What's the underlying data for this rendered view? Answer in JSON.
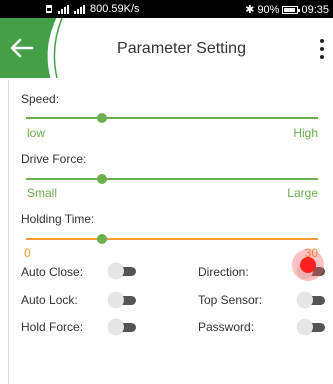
{
  "status_bar": {
    "net_speed": "800.59K/s",
    "bluetooth_symbol": "✱",
    "battery_percent": "90%",
    "battery_level": 0.9,
    "time": "09:35"
  },
  "header": {
    "title": "Parameter Setting",
    "back_icon": "arrow-left-icon",
    "menu_icon": "more-vert-icon"
  },
  "colors": {
    "accent_green": "#6ab04c",
    "header_green": "#44a047",
    "orange": "#f29b38",
    "touch_red": "#ff2020"
  },
  "sliders": [
    {
      "label": "Speed:",
      "min_label": "low",
      "max_label": "High",
      "value_fraction": 0.26,
      "color": "#6ab04c"
    },
    {
      "label": "Drive Force:",
      "min_label": "Small",
      "max_label": "Large",
      "value_fraction": 0.26,
      "color": "#6ab04c"
    },
    {
      "label": "Holding Time:",
      "min_label": "0",
      "max_label": "30",
      "value_fraction": 0.26,
      "color": "#f29b38"
    }
  ],
  "toggles": {
    "auto_close": {
      "label": "Auto Close:",
      "on": false
    },
    "direction": {
      "label": "Direction:",
      "on": false
    },
    "auto_lock": {
      "label": "Auto Lock:",
      "on": false
    },
    "top_sensor": {
      "label": "Top Sensor:",
      "on": false
    },
    "hold_force": {
      "label": "Hold Force:",
      "on": false
    },
    "password": {
      "label": "Password:",
      "on": false
    }
  }
}
